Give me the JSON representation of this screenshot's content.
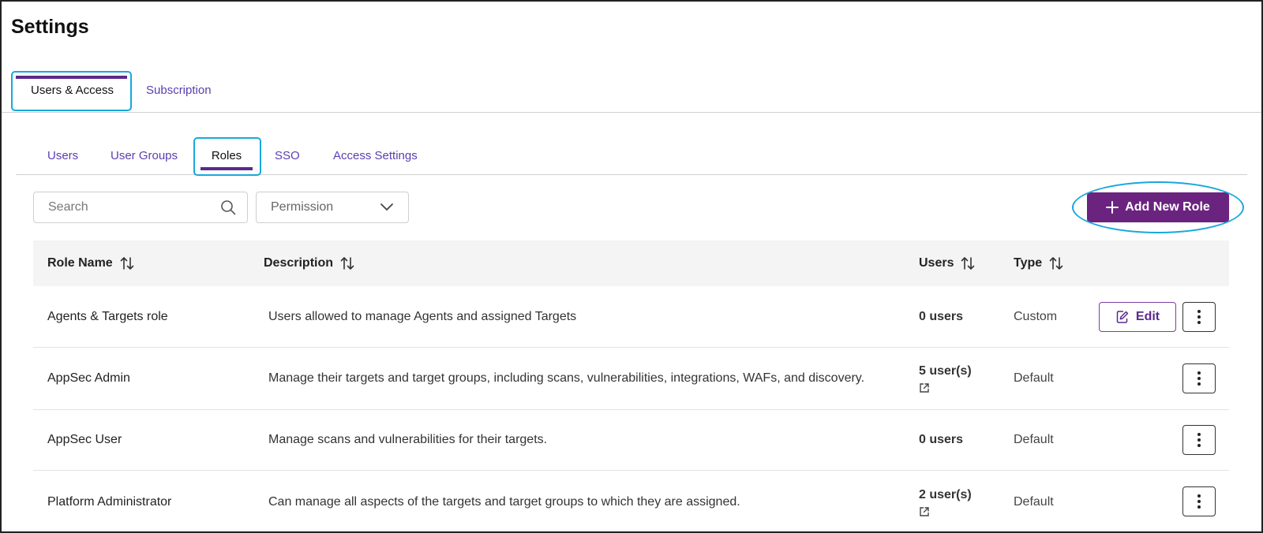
{
  "page": {
    "title": "Settings"
  },
  "main_tabs": [
    {
      "label": "Users & Access",
      "active": true
    },
    {
      "label": "Subscription",
      "active": false
    }
  ],
  "sub_tabs": [
    {
      "label": "Users",
      "active": false
    },
    {
      "label": "User Groups",
      "active": false
    },
    {
      "label": "Roles",
      "active": true
    },
    {
      "label": "SSO",
      "active": false
    },
    {
      "label": "Access Settings",
      "active": false
    }
  ],
  "toolbar": {
    "search_placeholder": "Search",
    "permission_label": "Permission",
    "add_button_label": "Add New Role"
  },
  "table": {
    "headers": {
      "role_name": "Role Name",
      "description": "Description",
      "users": "Users",
      "type": "Type"
    },
    "edit_label": "Edit",
    "rows": [
      {
        "name": "Agents & Targets role",
        "description": "Users allowed to manage Agents and assigned Targets",
        "users": "0 users",
        "has_link": false,
        "type": "Custom",
        "editable": true
      },
      {
        "name": "AppSec Admin",
        "description": "Manage their targets and target groups, including scans, vulnerabilities, integrations, WAFs, and discovery.",
        "users": "5 user(s)",
        "has_link": true,
        "type": "Default",
        "editable": false
      },
      {
        "name": "AppSec User",
        "description": "Manage scans and vulnerabilities for their targets.",
        "users": "0 users",
        "has_link": false,
        "type": "Default",
        "editable": false
      },
      {
        "name": "Platform Administrator",
        "description": "Can manage all aspects of the targets and target groups to which they are assigned.",
        "users": "2 user(s)",
        "has_link": true,
        "type": "Default",
        "editable": false
      }
    ]
  },
  "colors": {
    "accent": "#6b2380",
    "tab_link": "#5a3fb0",
    "highlight": "#1aa7dc"
  },
  "icons": {
    "search": "search-icon",
    "dropdown": "chevron-down-icon",
    "add": "plus-icon",
    "sort": "sort-icon",
    "edit": "edit-icon",
    "more": "more-vertical-icon",
    "external": "external-link-icon"
  }
}
